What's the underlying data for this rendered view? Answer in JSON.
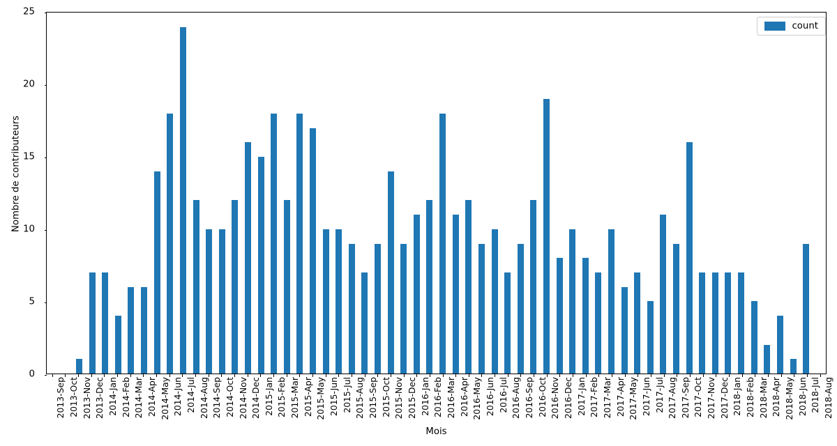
{
  "chart_data": {
    "type": "bar",
    "title": "",
    "xlabel": "Mois",
    "ylabel": "Nombre de contributeurs",
    "ylim": [
      0,
      25
    ],
    "yticks": [
      0,
      5,
      10,
      15,
      20,
      25
    ],
    "grid": false,
    "legend_position": "upper right",
    "bar_color": "#1f77b4",
    "series": [
      {
        "name": "count",
        "values": [
          0,
          0,
          1,
          7,
          7,
          4,
          6,
          6,
          14,
          18,
          24,
          12,
          10,
          10,
          12,
          16,
          15,
          18,
          12,
          18,
          17,
          10,
          10,
          9,
          7,
          9,
          14,
          9,
          11,
          12,
          18,
          11,
          12,
          9,
          10,
          7,
          9,
          12,
          19,
          8,
          10,
          8,
          7,
          10,
          6,
          7,
          5,
          11,
          9,
          16,
          7,
          7,
          7,
          7,
          5,
          2,
          4,
          1,
          9,
          0
        ]
      }
    ],
    "categories": [
      "2013-Sep",
      "2013-Oct",
      "2013-Nov",
      "2013-Dec",
      "2014-Jan",
      "2014-Feb",
      "2014-Mar",
      "2014-Apr",
      "2014-May",
      "2014-Jun",
      "2014-Jul",
      "2014-Aug",
      "2014-Sep",
      "2014-Oct",
      "2014-Nov",
      "2014-Dec",
      "2015-Jan",
      "2015-Feb",
      "2015-Mar",
      "2015-Apr",
      "2015-May",
      "2015-Jun",
      "2015-Jul",
      "2015-Aug",
      "2015-Sep",
      "2015-Oct",
      "2015-Nov",
      "2015-Dec",
      "2016-Jan",
      "2016-Feb",
      "2016-Mar",
      "2016-Apr",
      "2016-May",
      "2016-Jun",
      "2016-Jul",
      "2016-Aug",
      "2016-Sep",
      "2016-Oct",
      "2016-Nov",
      "2016-Dec",
      "2017-Jan",
      "2017-Feb",
      "2017-Mar",
      "2017-Apr",
      "2017-May",
      "2017-Jun",
      "2017-Jul",
      "2017-Aug",
      "2017-Sep",
      "2017-Oct",
      "2017-Nov",
      "2017-Dec",
      "2018-Jan",
      "2018-Feb",
      "2018-Mar",
      "2018-Apr",
      "2018-May",
      "2018-Jun",
      "2018-Jul",
      "2018-Aug"
    ]
  },
  "legend": {
    "entries": [
      {
        "label": "count",
        "color": "#1f77b4"
      }
    ]
  }
}
